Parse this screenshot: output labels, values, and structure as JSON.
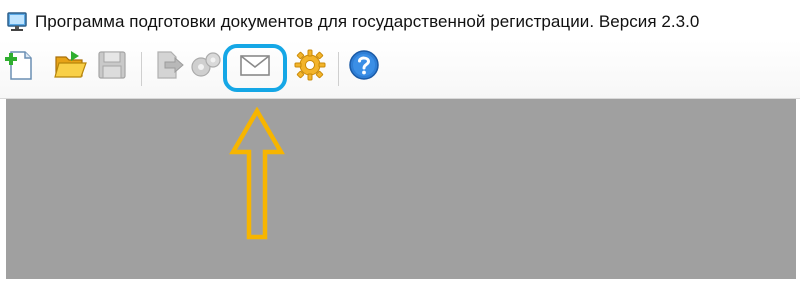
{
  "window": {
    "title": "Программа подготовки документов для государственной регистрации. Версия 2.3.0",
    "app_icon": "monitor-icon"
  },
  "toolbar": {
    "buttons": [
      {
        "id": "new",
        "icon": "new-document-icon",
        "enabled": true
      },
      {
        "id": "open",
        "icon": "open-folder-icon",
        "enabled": true
      },
      {
        "id": "save",
        "icon": "save-disk-icon",
        "enabled": false
      },
      {
        "id": "export",
        "icon": "export-document-icon",
        "enabled": false
      },
      {
        "id": "batch",
        "icon": "batch-gears-icon",
        "enabled": false
      },
      {
        "id": "send",
        "icon": "envelope-icon",
        "enabled": true,
        "highlighted": true
      },
      {
        "id": "settings",
        "icon": "settings-gear-icon",
        "enabled": true
      },
      {
        "id": "help",
        "icon": "help-question-icon",
        "enabled": true
      }
    ]
  },
  "annotation": {
    "highlight_color": "#15a7e6",
    "arrow_color": "#f7b500",
    "target": "envelope-icon"
  },
  "workspace": {
    "background": "#a0a0a0"
  }
}
